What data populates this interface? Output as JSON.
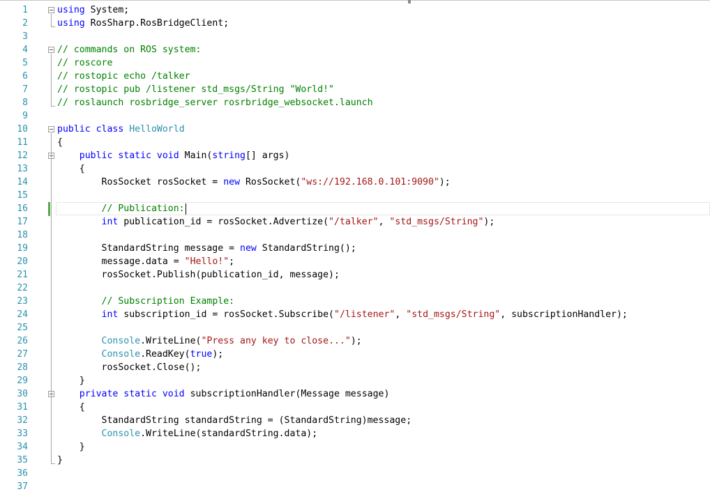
{
  "colors": {
    "keyword": "#0000ff",
    "comment": "#008000",
    "string": "#a31515",
    "type": "#2b91af",
    "line_number": "#2b91af",
    "text": "#000000"
  },
  "lines": [
    {
      "n": "1",
      "segments": [
        {
          "t": "kw",
          "v": "using"
        },
        {
          "t": "p",
          "v": " System;"
        }
      ]
    },
    {
      "n": "2",
      "segments": [
        {
          "t": "kw",
          "v": "using"
        },
        {
          "t": "p",
          "v": " RosSharp.RosBridgeClient;"
        }
      ]
    },
    {
      "n": "3",
      "segments": []
    },
    {
      "n": "4",
      "segments": [
        {
          "t": "cm",
          "v": "// commands on ROS system:"
        }
      ]
    },
    {
      "n": "5",
      "segments": [
        {
          "t": "cm",
          "v": "// roscore"
        }
      ]
    },
    {
      "n": "6",
      "segments": [
        {
          "t": "cm",
          "v": "// rostopic echo /talker"
        }
      ]
    },
    {
      "n": "7",
      "segments": [
        {
          "t": "cm",
          "v": "// rostopic pub /listener std_msgs/String \"World!\""
        }
      ]
    },
    {
      "n": "8",
      "segments": [
        {
          "t": "cm",
          "v": "// roslaunch rosbridge_server rosrbridge_websocket.launch"
        }
      ]
    },
    {
      "n": "9",
      "segments": []
    },
    {
      "n": "10",
      "segments": [
        {
          "t": "kw",
          "v": "public class"
        },
        {
          "t": "p",
          "v": " "
        },
        {
          "t": "ty",
          "v": "HelloWorld"
        }
      ]
    },
    {
      "n": "11",
      "segments": [
        {
          "t": "p",
          "v": "{"
        }
      ]
    },
    {
      "n": "12",
      "segments": [
        {
          "t": "p",
          "v": "    "
        },
        {
          "t": "kw",
          "v": "public static void"
        },
        {
          "t": "p",
          "v": " Main("
        },
        {
          "t": "kw",
          "v": "string"
        },
        {
          "t": "p",
          "v": "[] args)"
        }
      ]
    },
    {
      "n": "13",
      "segments": [
        {
          "t": "p",
          "v": "    {"
        }
      ]
    },
    {
      "n": "14",
      "segments": [
        {
          "t": "p",
          "v": "        RosSocket rosSocket = "
        },
        {
          "t": "kw",
          "v": "new"
        },
        {
          "t": "p",
          "v": " RosSocket("
        },
        {
          "t": "st",
          "v": "\"ws://192.168.0.101:9090\""
        },
        {
          "t": "p",
          "v": ");"
        }
      ]
    },
    {
      "n": "15",
      "segments": []
    },
    {
      "n": "16",
      "segments": [
        {
          "t": "p",
          "v": "        "
        },
        {
          "t": "cm",
          "v": "// Publication:"
        }
      ]
    },
    {
      "n": "17",
      "segments": [
        {
          "t": "p",
          "v": "        "
        },
        {
          "t": "kw",
          "v": "int"
        },
        {
          "t": "p",
          "v": " publication_id = rosSocket.Advertize("
        },
        {
          "t": "st",
          "v": "\"/talker\""
        },
        {
          "t": "p",
          "v": ", "
        },
        {
          "t": "st",
          "v": "\"std_msgs/String\""
        },
        {
          "t": "p",
          "v": ");"
        }
      ]
    },
    {
      "n": "18",
      "segments": []
    },
    {
      "n": "19",
      "segments": [
        {
          "t": "p",
          "v": "        StandardString message = "
        },
        {
          "t": "kw",
          "v": "new"
        },
        {
          "t": "p",
          "v": " StandardString();"
        }
      ]
    },
    {
      "n": "20",
      "segments": [
        {
          "t": "p",
          "v": "        message.data = "
        },
        {
          "t": "st",
          "v": "\"Hello!\""
        },
        {
          "t": "p",
          "v": ";"
        }
      ]
    },
    {
      "n": "21",
      "segments": [
        {
          "t": "p",
          "v": "        rosSocket.Publish(publication_id, message);"
        }
      ]
    },
    {
      "n": "22",
      "segments": []
    },
    {
      "n": "23",
      "segments": [
        {
          "t": "p",
          "v": "        "
        },
        {
          "t": "cm",
          "v": "// Subscription Example:"
        }
      ]
    },
    {
      "n": "24",
      "segments": [
        {
          "t": "p",
          "v": "        "
        },
        {
          "t": "kw",
          "v": "int"
        },
        {
          "t": "p",
          "v": " subscription_id = rosSocket.Subscribe("
        },
        {
          "t": "st",
          "v": "\"/listener\""
        },
        {
          "t": "p",
          "v": ", "
        },
        {
          "t": "st",
          "v": "\"std_msgs/String\""
        },
        {
          "t": "p",
          "v": ", subscriptionHandler);"
        }
      ]
    },
    {
      "n": "25",
      "segments": []
    },
    {
      "n": "26",
      "segments": [
        {
          "t": "p",
          "v": "        "
        },
        {
          "t": "ty",
          "v": "Console"
        },
        {
          "t": "p",
          "v": ".WriteLine("
        },
        {
          "t": "st",
          "v": "\"Press any key to close...\""
        },
        {
          "t": "p",
          "v": ");"
        }
      ]
    },
    {
      "n": "27",
      "segments": [
        {
          "t": "p",
          "v": "        "
        },
        {
          "t": "ty",
          "v": "Console"
        },
        {
          "t": "p",
          "v": ".ReadKey("
        },
        {
          "t": "kw",
          "v": "true"
        },
        {
          "t": "p",
          "v": ");"
        }
      ]
    },
    {
      "n": "28",
      "segments": [
        {
          "t": "p",
          "v": "        rosSocket.Close();"
        }
      ]
    },
    {
      "n": "29",
      "segments": [
        {
          "t": "p",
          "v": "    }"
        }
      ]
    },
    {
      "n": "30",
      "segments": [
        {
          "t": "p",
          "v": "    "
        },
        {
          "t": "kw",
          "v": "private static void"
        },
        {
          "t": "p",
          "v": " subscriptionHandler(Message message)"
        }
      ]
    },
    {
      "n": "31",
      "segments": [
        {
          "t": "p",
          "v": "    {"
        }
      ]
    },
    {
      "n": "32",
      "segments": [
        {
          "t": "p",
          "v": "        StandardString standardString = (StandardString)message;"
        }
      ]
    },
    {
      "n": "33",
      "segments": [
        {
          "t": "p",
          "v": "        "
        },
        {
          "t": "ty",
          "v": "Console"
        },
        {
          "t": "p",
          "v": ".WriteLine(standardString.data);"
        }
      ]
    },
    {
      "n": "34",
      "segments": [
        {
          "t": "p",
          "v": "    }"
        }
      ]
    },
    {
      "n": "35",
      "segments": [
        {
          "t": "p",
          "v": "}"
        }
      ]
    },
    {
      "n": "36",
      "segments": []
    },
    {
      "n": "37",
      "segments": []
    }
  ],
  "fold_markers": [
    "1",
    "4",
    "10",
    "12",
    "30"
  ]
}
